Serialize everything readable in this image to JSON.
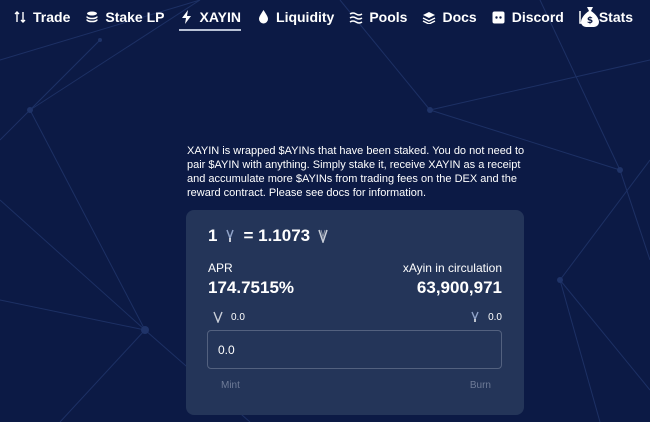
{
  "nav": {
    "items": [
      {
        "label": "Trade",
        "icon": "trade-icon"
      },
      {
        "label": "Stake LP",
        "icon": "stake-coins-icon"
      },
      {
        "label": "XAYIN",
        "icon": "lightning-icon",
        "active": true
      },
      {
        "label": "Liquidity",
        "icon": "droplet-icon"
      },
      {
        "label": "Pools",
        "icon": "pools-wave-icon"
      },
      {
        "label": "Docs",
        "icon": "layers-icon"
      },
      {
        "label": "Discord",
        "icon": "discord-icon"
      },
      {
        "label": "Stats",
        "icon": "chart-line-icon"
      }
    ],
    "extra_icon": "money-bag-icon"
  },
  "description": "XAYIN is wrapped $AYINs that have been staked. You do not need to pair $AYIN with anything. Simply stake it, receive XAYIN as a receipt and accumulate more $AYINs from trading fees on the DEX and the reward contract. Please see docs for information.",
  "rate": {
    "left": "1",
    "equals": "= 1.1073"
  },
  "apr": {
    "label": "APR",
    "value": "174.7515%"
  },
  "circulation": {
    "label": "xAyin in circulation",
    "value": "63,900,971"
  },
  "balances": {
    "ayin": "0.0",
    "xayin": "0.0"
  },
  "input": {
    "placeholder": "0.0"
  },
  "buttons": {
    "mint": "Mint",
    "burn": "Burn"
  },
  "colors": {
    "background": "#0c1a45",
    "card": "#243559",
    "muted": "#6e7b97"
  }
}
